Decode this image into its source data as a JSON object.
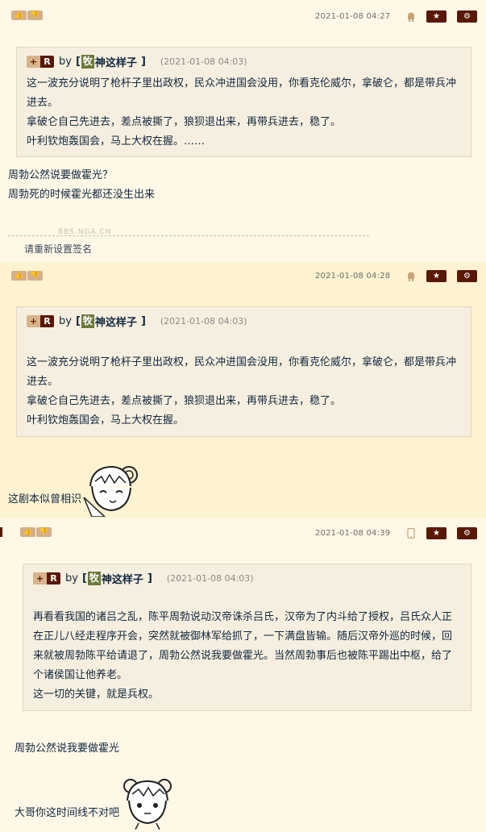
{
  "posts": [
    {
      "date": "2021-01-08 04:27",
      "quote": {
        "by": "by",
        "user_tag": "牧",
        "user_name": "神这样子",
        "time": "(2021-01-08 04:03)",
        "lines": [
          "这一波充分说明了枪杆子里出政权，民众冲进国会没用，你看克伦威尔，拿破仑，都是带兵冲",
          "进去。",
          "拿破仑自己先进去，差点被撕了，狼狈退出来，再带兵进去，稳了。",
          "叶利钦炮轰国会，马上大权在握。……"
        ]
      },
      "body": [
        "周勃公然说要做霍光？",
        "周勃死的时候霍光都还没生出来"
      ],
      "sig_tag": "BBS.NGA.CN",
      "signature": "请重新设置签名"
    },
    {
      "date": "2021-01-08 04:28",
      "quote": {
        "by": "by",
        "user_tag": "牧",
        "user_name": "神这样子",
        "time": "(2021-01-08 04:03)",
        "lines": [
          "这一波充分说明了枪杆子里出政权，民众冲进国会没用，你看克伦威尔，拿破仑，都是带兵冲",
          "进去。",
          "拿破仑自己先进去，差点被撕了，狼狈退出来，再带兵进去，稳了。",
          "叶利钦炮轰国会，马上大权在握。"
        ]
      },
      "body": [
        "这剧本似曾相识"
      ]
    },
    {
      "date": "2021-01-08 04:39",
      "quote": {
        "by": "by",
        "user_tag": "牧",
        "user_name": "神这样子",
        "time": "(2021-01-08 04:03)",
        "lines": [
          "再看看我国的诸吕之乱，陈平周勃说动汉帝诛杀吕氏，汉帝为了内斗给了授权，吕氏众人正",
          "在正儿八经走程序开会，突然就被御林军给抓了，一下满盘皆输。随后汉帝外巡的时候，回",
          "来就被周勃陈平给请退了，周勃公然说我要做霍光。当然周勃事后也被陈平踢出中枢，给了",
          "个诸侯国让他养老。",
          "这一切的关键，就是兵权。"
        ]
      },
      "body": [
        "周勃公然说我要做霍光",
        "大哥你这时间线不对吧"
      ]
    }
  ],
  "buttons": {
    "plus": "+",
    "reply": "R",
    "star": "★",
    "gear": "⚙",
    "thumb_up": "👍",
    "thumb_down": "👎"
  },
  "colors": {
    "brand": "#591804",
    "accent": "#d4b08a",
    "bg_odd": "#fff8e7",
    "bg_even": "#fef3d1"
  },
  "icons": [
    "thumb-up-icon",
    "thumb-down-icon",
    "android-icon",
    "phone-icon",
    "star-icon",
    "gear-icon"
  ]
}
